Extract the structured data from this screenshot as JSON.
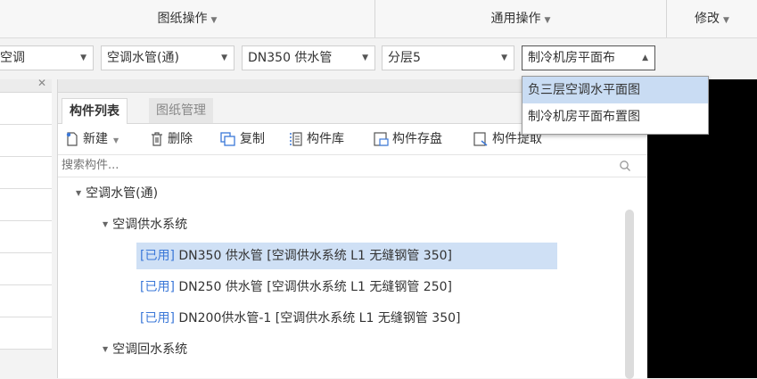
{
  "ribbon": {
    "groups": [
      {
        "label": "图纸操作"
      },
      {
        "label": "通用操作"
      },
      {
        "label": "修改"
      }
    ]
  },
  "combos": {
    "c1": "空调",
    "c2": "空调水管(通)",
    "c3": "DN350 供水管",
    "c4": "分层5",
    "c5": "制冷机房平面布"
  },
  "dropdown": {
    "items": [
      "负三层空调水平面图",
      "制冷机房平面布置图"
    ],
    "selected_index": 0
  },
  "panel": {
    "tabs": [
      "构件列表",
      "图纸管理"
    ],
    "toolbar": {
      "new": "新建",
      "delete": "删除",
      "copy": "复制",
      "library": "构件库",
      "save": "构件存盘",
      "extract": "构件提取"
    },
    "search_placeholder": "搜索构件..."
  },
  "tree": {
    "root": "空调水管(通)",
    "supply_group": "空调供水系统",
    "items": [
      {
        "tag": "[已用]",
        "text": " DN350 供水管 [空调供水系统 L1 无缝钢管 350]"
      },
      {
        "tag": "[已用]",
        "text": " DN250 供水管 [空调供水系统 L1 无缝钢管 250]"
      },
      {
        "tag": "[已用]",
        "text": " DN200供水管-1 [空调供水系统 L1 无缝钢管 350]"
      }
    ],
    "return_group": "空调回水系统"
  },
  "colors": {
    "accent": "#3b78d8",
    "selection": "#cfe0f5"
  }
}
